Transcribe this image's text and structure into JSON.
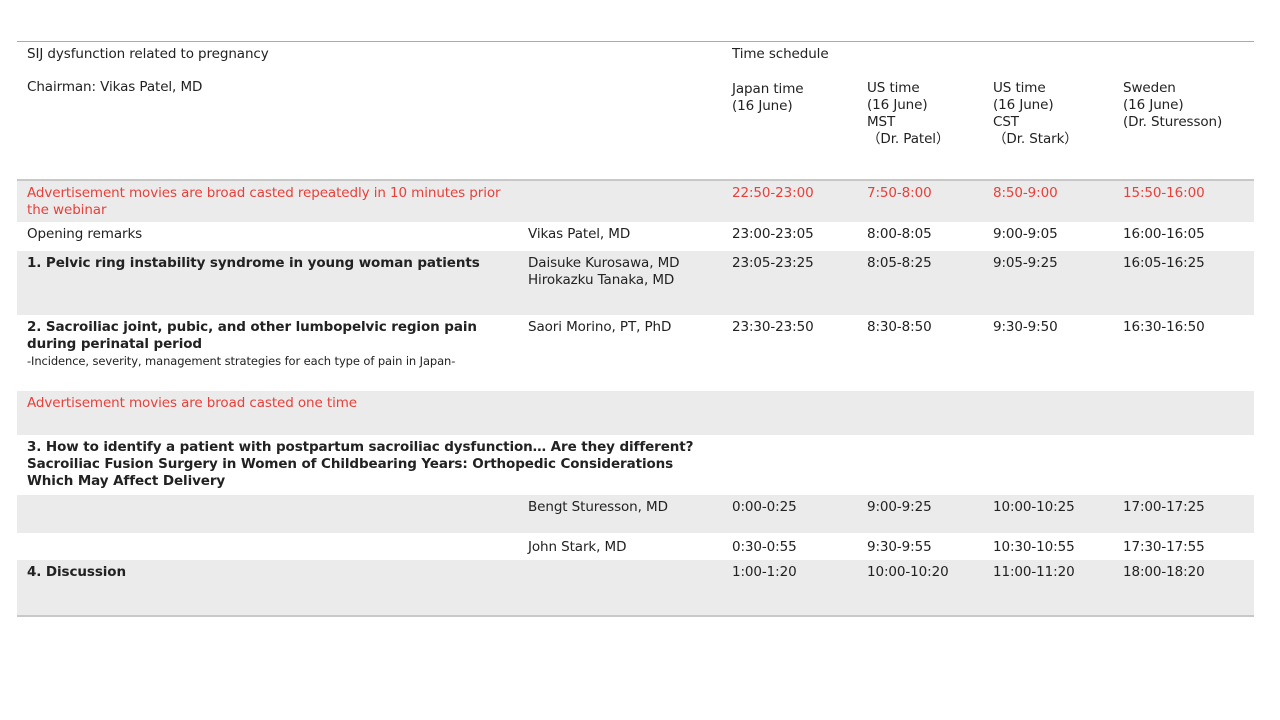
{
  "header": {
    "title": "SIJ dysfunction related to pregnancy",
    "chairman": "Chairman: Vikas Patel, MD",
    "time_schedule": "Time schedule",
    "columns": [
      {
        "line1": "Japan time",
        "line2": "(16 June)",
        "line3": "",
        "line4": ""
      },
      {
        "line1": "US time",
        "line2": "(16 June)",
        "line3": "MST",
        "line4": "（Dr. Patel）"
      },
      {
        "line1": "US time",
        "line2": "(16 June)",
        "line3": "CST",
        "line4": "（Dr. Stark）"
      },
      {
        "line1": "Sweden",
        "line2": "(16 June)",
        "line3": "(Dr. Sturesson)",
        "line4": ""
      }
    ]
  },
  "rows": [
    {
      "program": "Advertisement movies are broad casted repeatedly in 10 minutes prior the webinar",
      "speaker": "",
      "japan": "22:50-23:00",
      "mst": "7:50-8:00",
      "cst": "8:50-9:00",
      "sweden": "15:50-16:00"
    },
    {
      "program": "Opening remarks",
      "speaker": "Vikas Patel, MD",
      "japan": "23:00-23:05",
      "mst": "8:00-8:05",
      "cst": "9:00-9:05",
      "sweden": "16:00-16:05"
    },
    {
      "program": "1. Pelvic ring instability syndrome in young woman patients",
      "speaker1": "Daisuke Kurosawa, MD",
      "speaker2": "Hirokazku Tanaka, MD",
      "japan": "23:05-23:25",
      "mst": "8:05-8:25",
      "cst": "9:05-9:25",
      "sweden": "16:05-16:25"
    },
    {
      "program": "2. Sacroiliac joint, pubic, and other lumbopelvic region pain during perinatal period",
      "note": "-Incidence, severity, management strategies for each type of pain in Japan-",
      "speaker": "Saori Morino, PT, PhD",
      "japan": "23:30-23:50",
      "mst": "8:30-8:50",
      "cst": "9:30-9:50",
      "sweden": "16:30-16:50"
    },
    {
      "program": "Advertisement movies are broad casted one time"
    },
    {
      "program1": "3. How to identify a patient with postpartum sacroiliac dysfunction… Are they different?",
      "program2": "Sacroiliac Fusion Surgery in Women of Childbearing Years: Orthopedic Considerations Which May Affect Delivery"
    },
    {
      "speaker": "Bengt Sturesson, MD",
      "japan": "0:00-0:25",
      "mst": "9:00-9:25",
      "cst": "10:00-10:25",
      "sweden": "17:00-17:25"
    },
    {
      "speaker": "John Stark, MD",
      "japan": "0:30-0:55",
      "mst": "9:30-9:55",
      "cst": "10:30-10:55",
      "sweden": "17:30-17:55"
    },
    {
      "program": "4. Discussion",
      "japan": "1:00-1:20",
      "mst": "10:00-10:20",
      "cst": "11:00-11:20",
      "sweden": "18:00-18:20"
    }
  ],
  "colors": {
    "highlight": "#e8403a",
    "shade": "#ebebeb"
  }
}
